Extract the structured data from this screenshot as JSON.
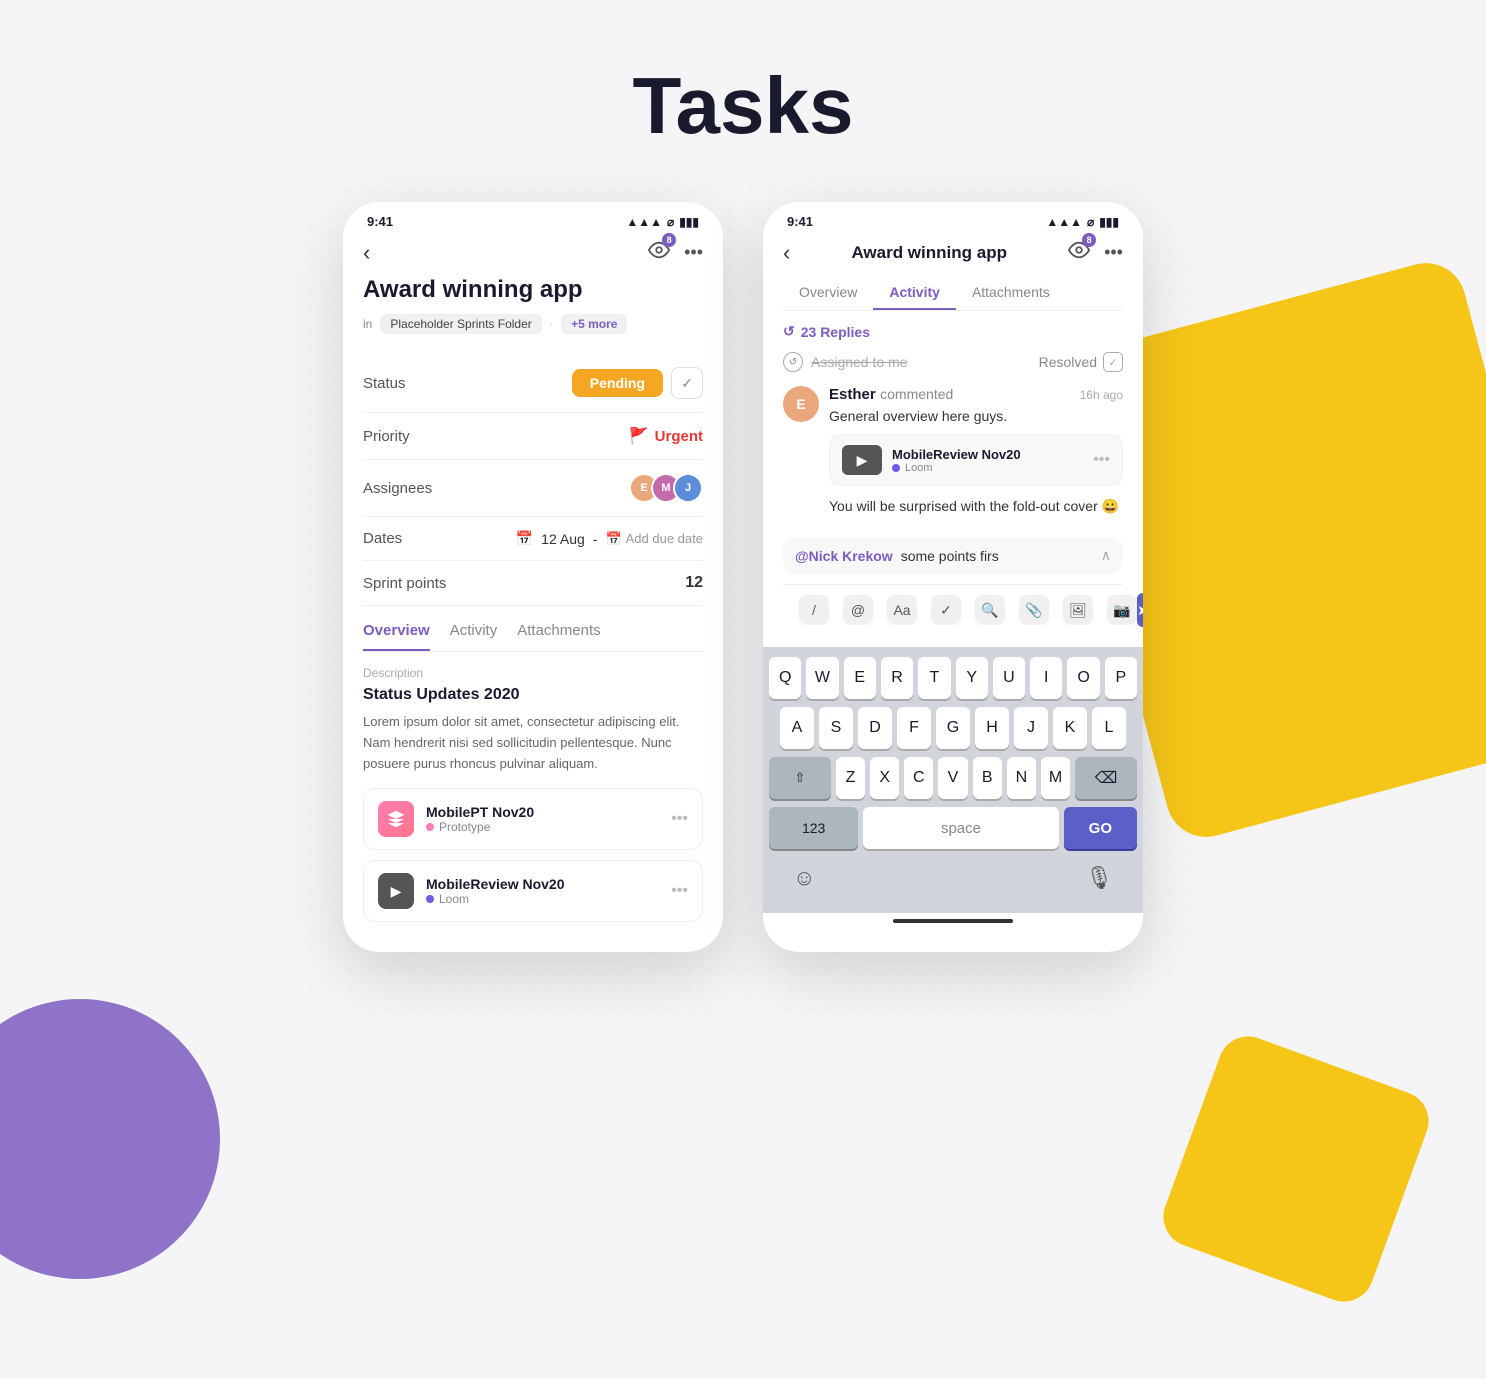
{
  "page": {
    "title": "Tasks",
    "bg_dots": true
  },
  "phone1": {
    "status_bar": {
      "time": "9:41",
      "signal": "▲▲▲",
      "wifi": "⌂",
      "battery": "🔋"
    },
    "nav": {
      "back_icon": "‹",
      "watch_icon": "👁",
      "badge": "8",
      "more_icon": "•••"
    },
    "task_title": "Award winning app",
    "breadcrumb_in": "in",
    "breadcrumb_tag": "Placeholder Sprints Folder",
    "breadcrumb_more": "+5 more",
    "fields": [
      {
        "label": "Status",
        "type": "status",
        "value": "Pending"
      },
      {
        "label": "Priority",
        "type": "priority",
        "value": "Urgent"
      },
      {
        "label": "Assignees",
        "type": "avatars"
      },
      {
        "label": "Dates",
        "type": "dates",
        "start": "12 Aug",
        "add": "Add due date"
      },
      {
        "label": "Sprint points",
        "type": "number",
        "value": "12"
      }
    ],
    "tabs": [
      {
        "label": "Overview",
        "active": true
      },
      {
        "label": "Activity",
        "active": false
      },
      {
        "label": "Attachments",
        "active": false
      }
    ],
    "description_label": "Description",
    "description_heading": "Status Updates 2020",
    "description_text": "Lorem ipsum dolor sit amet, consectetur adipiscing elit. Nam hendrerit nisi sed sollicitudin pellentesque. Nunc posuere purus rhoncus pulvinar aliquam.",
    "attachments": [
      {
        "name": "MobilePT Nov20",
        "sub": "Prototype",
        "type": "figma"
      },
      {
        "name": "MobileReview Nov20",
        "sub": "Loom",
        "type": "loom"
      }
    ]
  },
  "phone2": {
    "status_bar": {
      "time": "9:41"
    },
    "nav": {
      "back_icon": "‹",
      "title": "Award winning app",
      "watch_icon": "👁",
      "badge": "8",
      "more_icon": "•••"
    },
    "tabs": [
      {
        "label": "Overview",
        "active": false
      },
      {
        "label": "Activity",
        "active": true
      },
      {
        "label": "Attachments",
        "active": false
      }
    ],
    "replies": {
      "icon": "↺",
      "count": "23",
      "label": "Replies"
    },
    "assigned_to_me": "Assigned to me",
    "resolved": "Resolved",
    "comment": {
      "author": "Esther",
      "action": "commented",
      "time": "16h ago",
      "text": "General overview here guys."
    },
    "video_card": {
      "name": "MobileReview Nov20",
      "sub": "Loom",
      "play_icon": "▶"
    },
    "fold_text": "You will be surprised with the fold-out cover 😀",
    "reply_input": {
      "mention": "@Nick Krekow",
      "text": "some points firs"
    },
    "toolbar_icons": [
      "/",
      "@",
      "Aa",
      "✓",
      "🔍",
      "📎",
      "🖼",
      "📷"
    ],
    "send_label": "➤",
    "keyboard": {
      "rows": [
        [
          "Q",
          "W",
          "E",
          "R",
          "T",
          "Y",
          "U",
          "I",
          "O",
          "P"
        ],
        [
          "A",
          "S",
          "D",
          "F",
          "G",
          "H",
          "J",
          "K",
          "L"
        ],
        [
          "Z",
          "X",
          "C",
          "V",
          "B",
          "N",
          "M"
        ]
      ],
      "special_left": "⇧",
      "special_right": "⌫",
      "num_label": "123",
      "space_label": "space",
      "go_label": "GO"
    },
    "bottom_icons": {
      "emoji": "☺",
      "mic": "🎙"
    }
  }
}
